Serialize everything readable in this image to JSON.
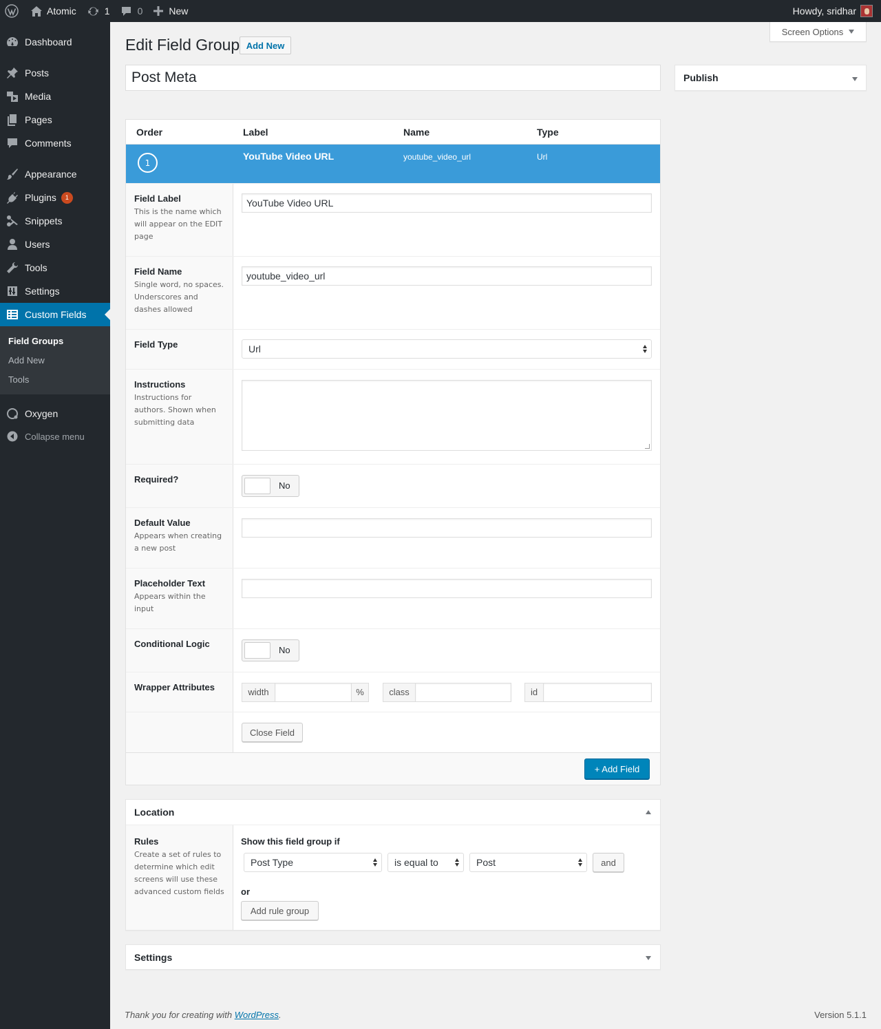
{
  "admin_bar": {
    "site_name": "Atomic",
    "updates_count": "1",
    "comments_count": "0",
    "new_label": "New",
    "greeting": "Howdy, sridhar"
  },
  "sidebar": {
    "items": [
      {
        "label": "Dashboard",
        "icon": "dashboard-icon"
      },
      {
        "label": "Posts",
        "icon": "pin-icon"
      },
      {
        "label": "Media",
        "icon": "media-icon"
      },
      {
        "label": "Pages",
        "icon": "pages-icon"
      },
      {
        "label": "Comments",
        "icon": "comment-icon"
      },
      {
        "label": "Appearance",
        "icon": "brush-icon"
      },
      {
        "label": "Plugins",
        "icon": "plugin-icon",
        "badge": "1"
      },
      {
        "label": "Snippets",
        "icon": "scissors-icon"
      },
      {
        "label": "Users",
        "icon": "user-icon"
      },
      {
        "label": "Tools",
        "icon": "wrench-icon"
      },
      {
        "label": "Settings",
        "icon": "settings-icon"
      },
      {
        "label": "Custom Fields",
        "icon": "table-icon"
      },
      {
        "label": "Oxygen",
        "icon": "oxygen-icon"
      },
      {
        "label": "Collapse menu",
        "icon": "collapse-icon"
      }
    ],
    "submenu": [
      "Field Groups",
      "Add New",
      "Tools"
    ]
  },
  "page": {
    "title": "Edit Field Group",
    "add_new": "Add New",
    "screen_options": "Screen Options",
    "post_title": "Post Meta",
    "publish_title": "Publish"
  },
  "fields": {
    "headers": [
      "Order",
      "Label",
      "Name",
      "Type"
    ],
    "row": {
      "order": "1",
      "label": "YouTube Video URL",
      "name": "youtube_video_url",
      "type": "Url"
    },
    "settings": {
      "field_label": {
        "label": "Field Label",
        "desc": "This is the name which will appear on the EDIT page",
        "value": "YouTube Video URL"
      },
      "field_name": {
        "label": "Field Name",
        "desc": "Single word, no spaces. Underscores and dashes allowed",
        "value": "youtube_video_url"
      },
      "field_type": {
        "label": "Field Type",
        "value": "Url"
      },
      "instructions": {
        "label": "Instructions",
        "desc": "Instructions for authors. Shown when submitting data"
      },
      "required": {
        "label": "Required?",
        "value": "No"
      },
      "default_value": {
        "label": "Default Value",
        "desc": "Appears when creating a new post"
      },
      "placeholder": {
        "label": "Placeholder Text",
        "desc": "Appears within the input"
      },
      "conditional": {
        "label": "Conditional Logic",
        "value": "No"
      },
      "wrapper": {
        "label": "Wrapper Attributes",
        "width": "width",
        "percent": "%",
        "class": "class",
        "id": "id"
      }
    },
    "close_field": "Close Field",
    "add_field": "+ Add Field"
  },
  "location": {
    "title": "Location",
    "rules_label": "Rules",
    "rules_desc": "Create a set of rules to determine which edit screens will use these advanced custom fields",
    "show_if": "Show this field group if",
    "param": "Post Type",
    "operator": "is equal to",
    "value": "Post",
    "and": "and",
    "or": "or",
    "add_rule_group": "Add rule group"
  },
  "settings_box": {
    "title": "Settings"
  },
  "footer": {
    "thanks": "Thank you for creating with ",
    "link": "WordPress",
    "period": ".",
    "version": "Version 5.1.1"
  },
  "colors": {
    "accent": "#0073aa",
    "selected_row": "#3a9bd9",
    "sidebar": "#23282d",
    "badge": "#ca4a1f"
  }
}
